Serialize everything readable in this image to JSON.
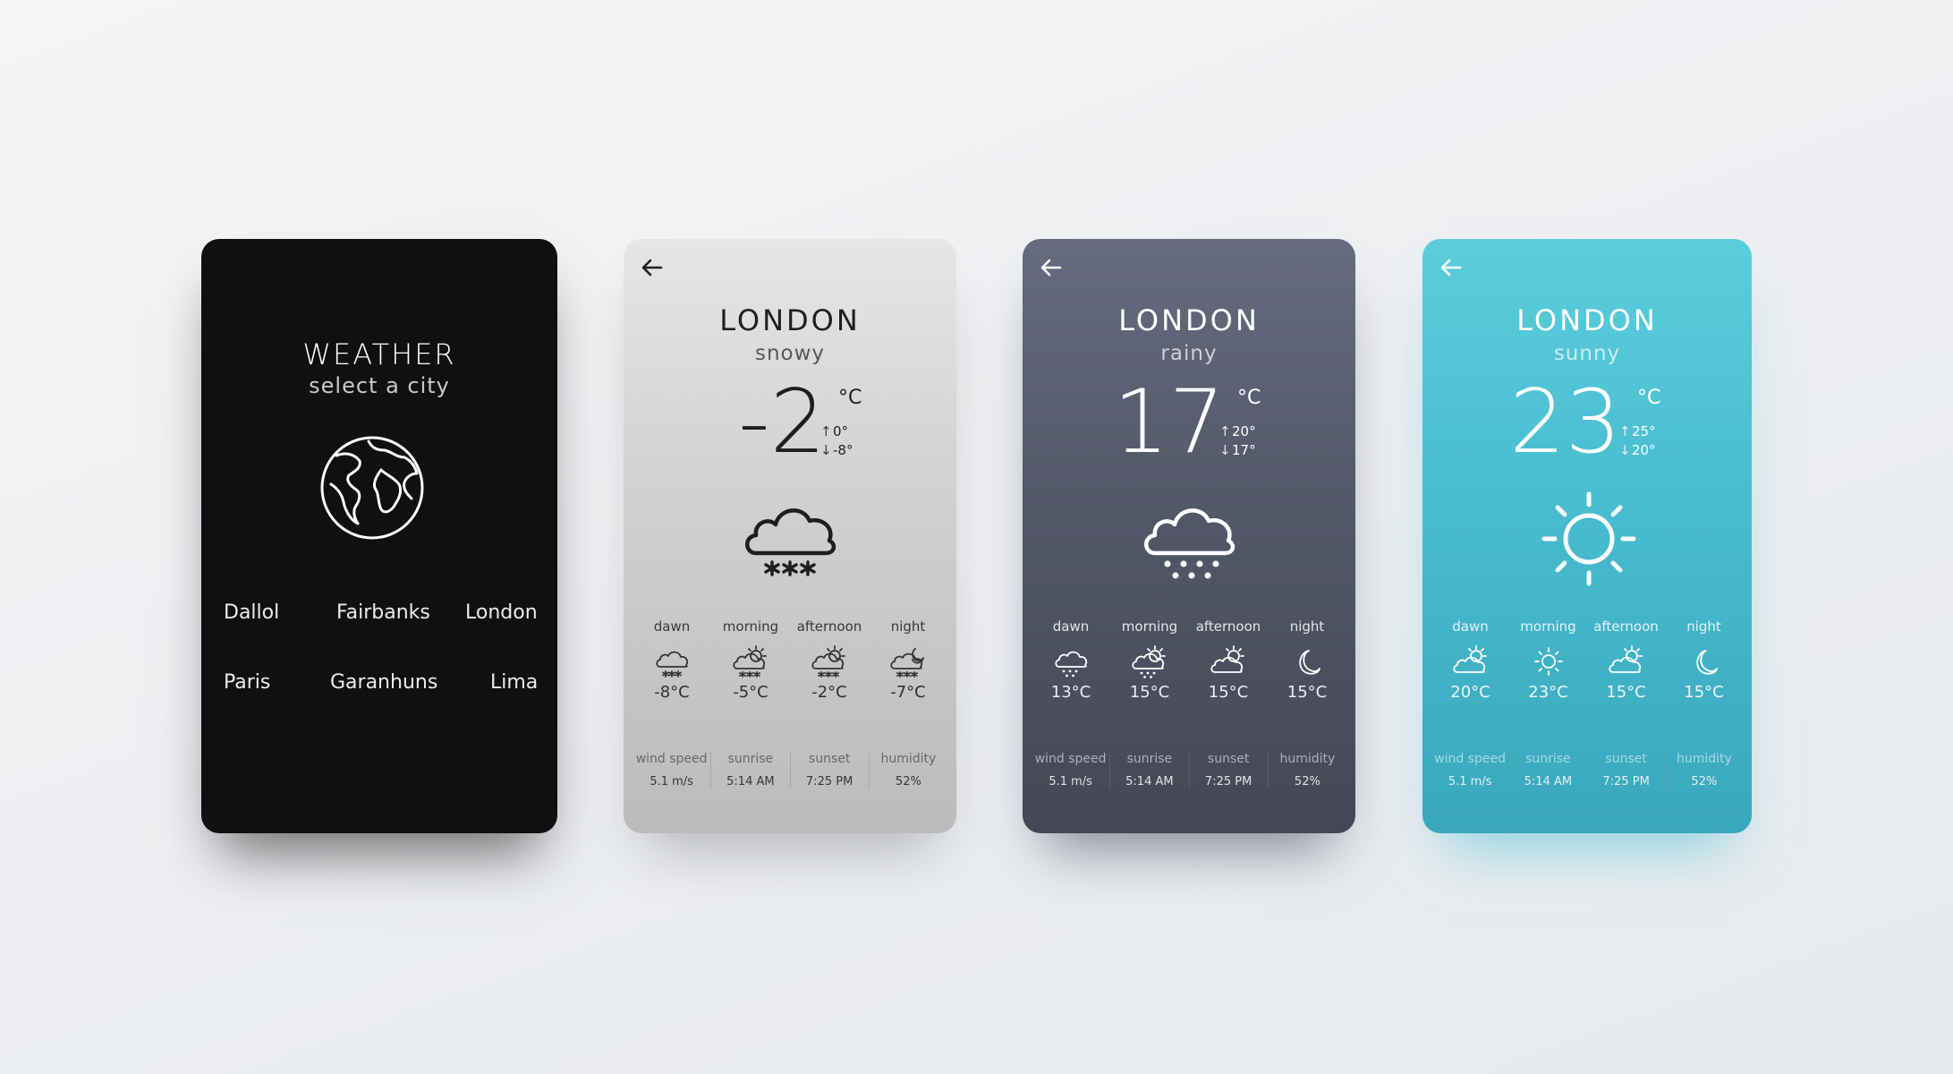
{
  "select": {
    "title": "WEATHER",
    "subtitle": "select a city",
    "cities": [
      "Dallol",
      "Fairbanks",
      "London",
      "Paris",
      "Garanhuns",
      "Lima"
    ]
  },
  "cards": [
    {
      "theme": "snowy",
      "city": "LONDON",
      "condition": "snowy",
      "temp": "-2",
      "unit": "°C",
      "high": "0°",
      "low": "-8°",
      "main_icon": "snow-cloud-icon",
      "periods": [
        {
          "label": "dawn",
          "temp": "-8°C",
          "icon": "snow-cloud-icon"
        },
        {
          "label": "morning",
          "temp": "-5°C",
          "icon": "sun-snow-cloud-icon"
        },
        {
          "label": "afternoon",
          "temp": "-2°C",
          "icon": "sun-snow-cloud-icon"
        },
        {
          "label": "night",
          "temp": "-7°C",
          "icon": "moon-snow-cloud-icon"
        }
      ],
      "stats": [
        {
          "label": "wind speed",
          "value": "5.1 m/s"
        },
        {
          "label": "sunrise",
          "value": "5:14 AM"
        },
        {
          "label": "sunset",
          "value": "7:25 PM"
        },
        {
          "label": "humidity",
          "value": "52%"
        }
      ]
    },
    {
      "theme": "rainy",
      "city": "LONDON",
      "condition": "rainy",
      "temp": "17",
      "unit": "°C",
      "high": "20°",
      "low": "17°",
      "main_icon": "rain-cloud-icon",
      "periods": [
        {
          "label": "dawn",
          "temp": "13°C",
          "icon": "rain-cloud-icon"
        },
        {
          "label": "morning",
          "temp": "15°C",
          "icon": "sun-rain-cloud-icon"
        },
        {
          "label": "afternoon",
          "temp": "15°C",
          "icon": "sun-cloud-icon"
        },
        {
          "label": "night",
          "temp": "15°C",
          "icon": "moon-icon"
        }
      ],
      "stats": [
        {
          "label": "wind speed",
          "value": "5.1 m/s"
        },
        {
          "label": "sunrise",
          "value": "5:14 AM"
        },
        {
          "label": "sunset",
          "value": "7:25 PM"
        },
        {
          "label": "humidity",
          "value": "52%"
        }
      ]
    },
    {
      "theme": "sunny",
      "city": "LONDON",
      "condition": "sunny",
      "temp": "23",
      "unit": "°C",
      "high": "25°",
      "low": "20°",
      "main_icon": "sun-icon",
      "periods": [
        {
          "label": "dawn",
          "temp": "20°C",
          "icon": "sun-cloud-icon"
        },
        {
          "label": "morning",
          "temp": "23°C",
          "icon": "sun-icon"
        },
        {
          "label": "afternoon",
          "temp": "15°C",
          "icon": "sun-cloud-icon"
        },
        {
          "label": "night",
          "temp": "15°C",
          "icon": "moon-icon"
        }
      ],
      "stats": [
        {
          "label": "wind speed",
          "value": "5.1 m/s"
        },
        {
          "label": "sunrise",
          "value": "5:14 AM"
        },
        {
          "label": "sunset",
          "value": "7:25 PM"
        },
        {
          "label": "humidity",
          "value": "52%"
        }
      ]
    }
  ]
}
